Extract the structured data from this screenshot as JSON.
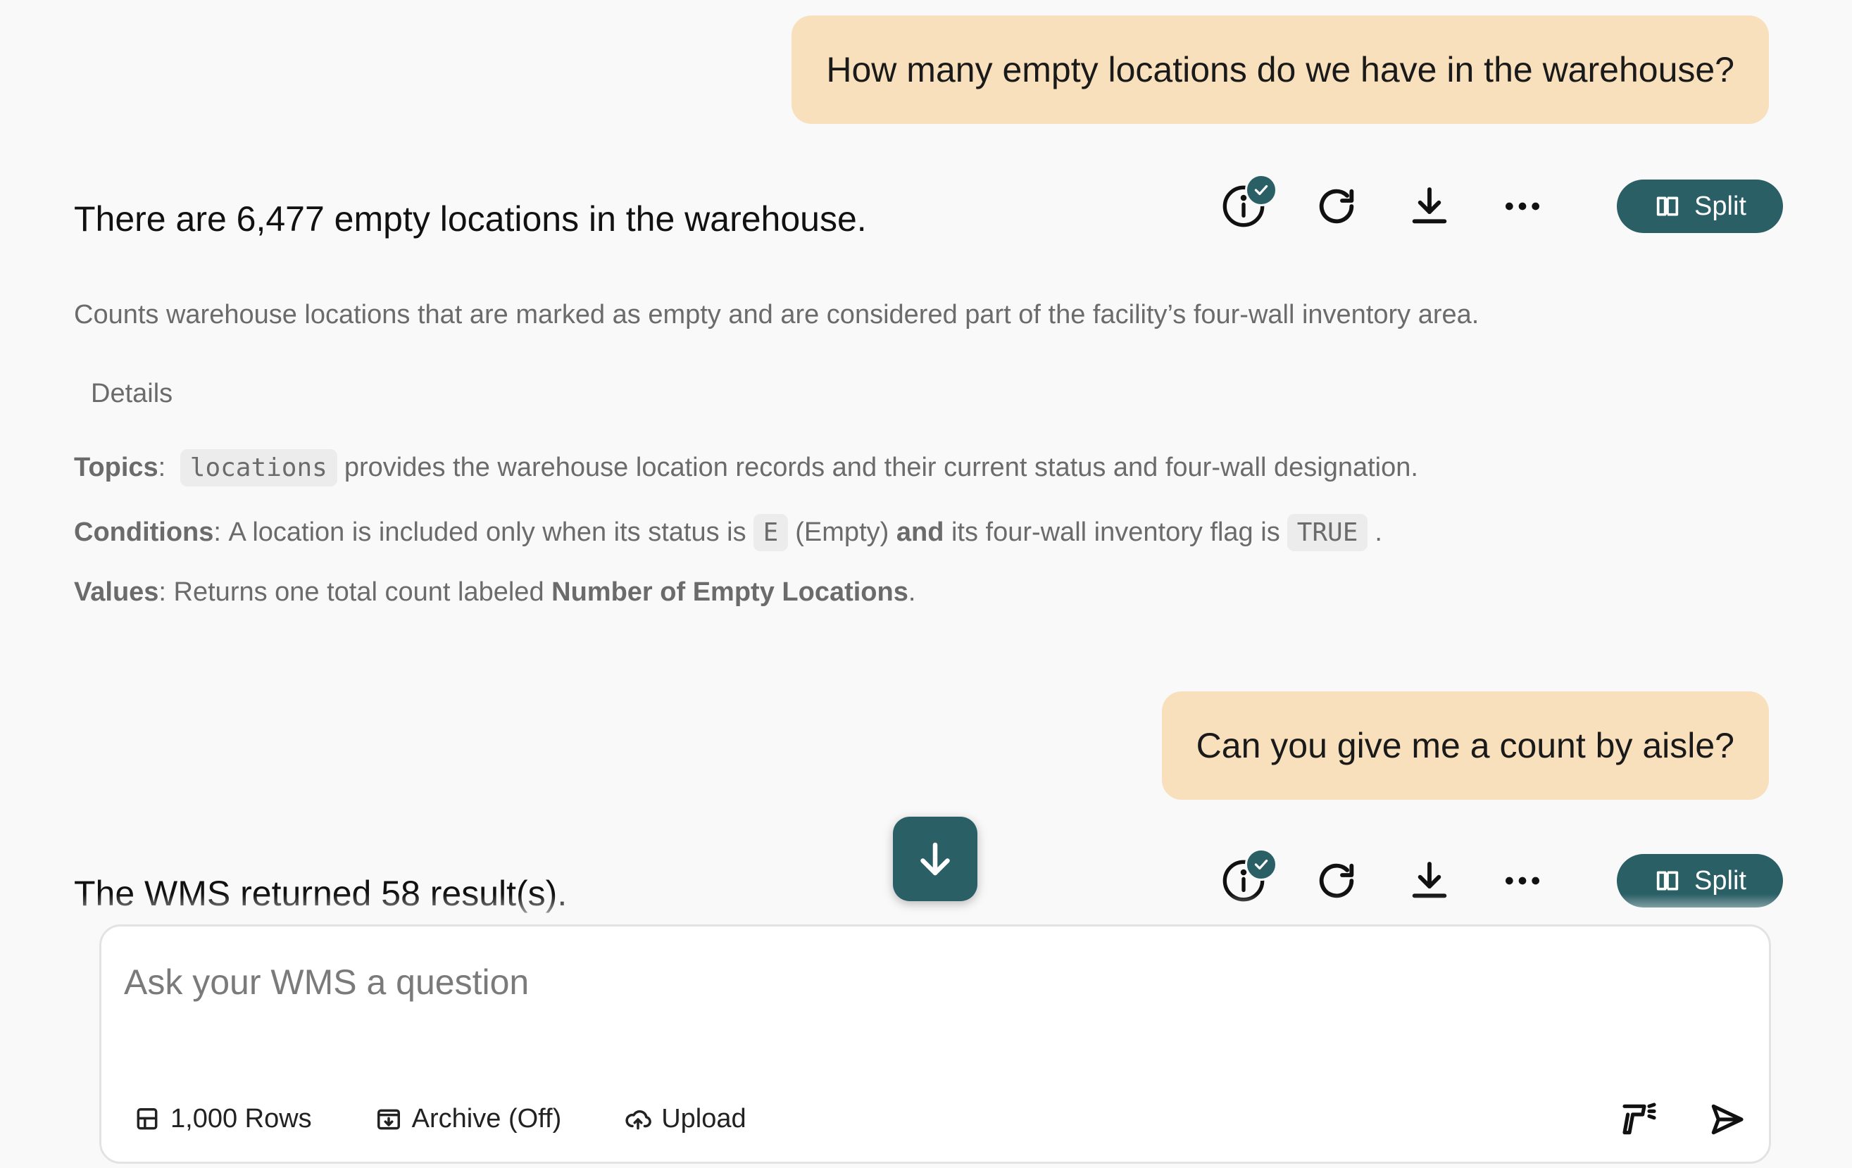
{
  "conversation": {
    "turn1": {
      "question": "How many empty locations do we have in the warehouse?",
      "answer": "There are 6,477 empty locations in the warehouse.",
      "explanation": "Counts warehouse locations that are marked as empty and are considered part of the facility’s four-wall inventory area.",
      "details_label": "Details",
      "topics": {
        "label": "Topics",
        "code": "locations",
        "text": "provides the warehouse location records and their current status and four-wall designation."
      },
      "conditions": {
        "label": "Conditions",
        "text_a": "A location is included only when its status is",
        "code_a": "E",
        "text_b": "(Empty)",
        "bold_and": "and",
        "text_c": "its four-wall inventory flag is",
        "code_b": "TRUE",
        "text_d": "."
      },
      "values": {
        "label": "Values",
        "text_a": "Returns one total count labeled",
        "bold": "Number of Empty Locations",
        "text_b": "."
      }
    },
    "turn2": {
      "question": "Can you give me a count by aisle?",
      "answer": "The WMS returned 58 result(s)."
    }
  },
  "actions": {
    "split_label": "Split",
    "icons": [
      "info-verified-icon",
      "refresh-icon",
      "download-icon",
      "more-icon",
      "split-view-icon"
    ]
  },
  "composer": {
    "placeholder": "Ask your WMS a question",
    "rows_label": "1,000 Rows",
    "archive_label": "Archive (Off)",
    "upload_label": "Upload"
  },
  "colors": {
    "accent": "#2a5f66",
    "user_bubble": "#f8e0bc",
    "background": "#f9f9f9",
    "muted_text": "#6b6b6b"
  }
}
